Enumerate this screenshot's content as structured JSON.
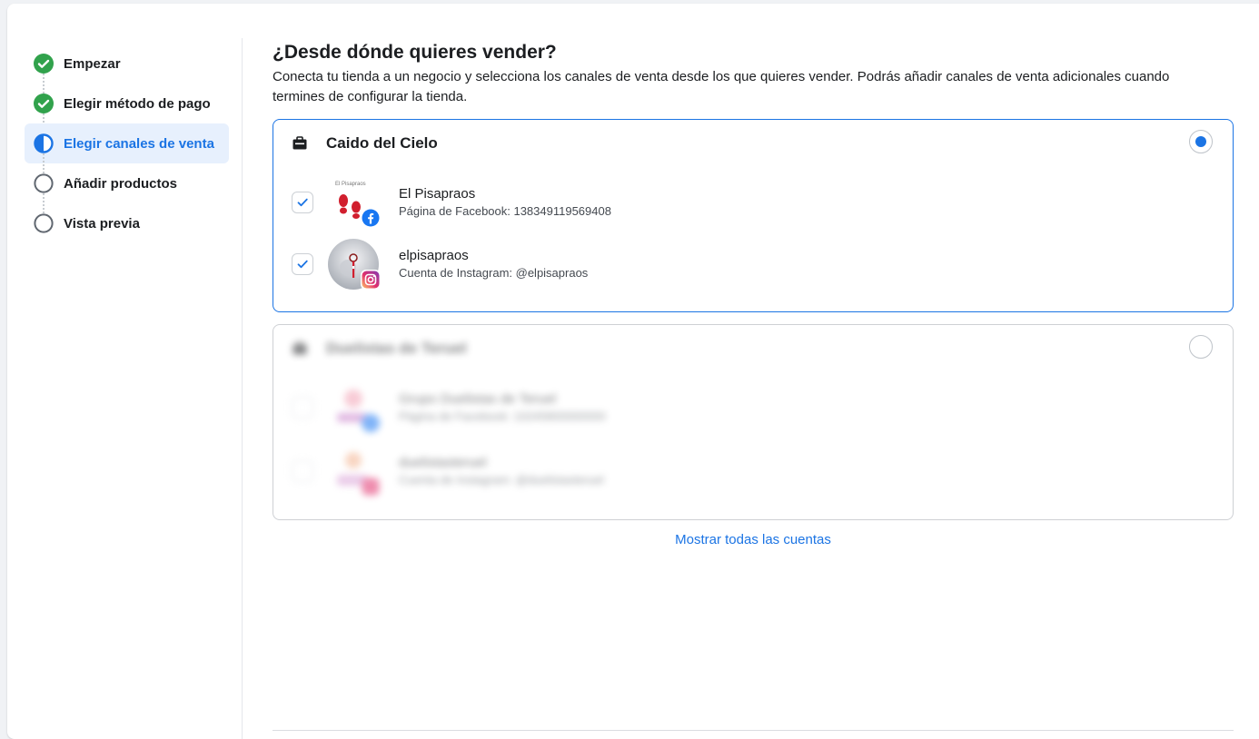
{
  "steps": [
    {
      "label": "Empezar",
      "state": "done"
    },
    {
      "label": "Elegir método de pago",
      "state": "done"
    },
    {
      "label": "Elegir canales de venta",
      "state": "current"
    },
    {
      "label": "Añadir productos",
      "state": "pending"
    },
    {
      "label": "Vista previa",
      "state": "pending"
    }
  ],
  "main": {
    "title": "¿Desde dónde quieres vender?",
    "description": "Conecta tu tienda a un negocio y selecciona los canales de venta desde los que quieres vender. Podrás añadir canales de venta adicionales cuando termines de configurar la tienda."
  },
  "business_selected": {
    "name": "Caido del Cielo",
    "icon": "briefcase-icon",
    "selected": true,
    "accounts": [
      {
        "avatar_caption": "El Pisapraos",
        "name": "El Pisapraos",
        "sub": "Página de Facebook: 138349119569408",
        "checked": true,
        "platform_icon": "facebook-icon"
      },
      {
        "name": "elpisapraos",
        "sub": "Cuenta de Instagram: @elpisapraos",
        "checked": true,
        "platform_icon": "instagram-icon"
      }
    ]
  },
  "business_other": {
    "name": "Duelistas de Teruel",
    "selected": false,
    "accounts": [
      {
        "name": "Grupo Duelistas de Teruel",
        "sub": "Página de Facebook: 10245800000000",
        "platform_icon": "facebook-icon"
      },
      {
        "name": "duelistasteruel",
        "sub": "Cuenta de Instagram: @duelistasteruel",
        "platform_icon": "instagram-icon"
      }
    ]
  },
  "show_all_label": "Mostrar todas las cuentas",
  "colors": {
    "accent": "#1b74e4",
    "success": "#31a24c",
    "facebook": "#1877f2"
  }
}
